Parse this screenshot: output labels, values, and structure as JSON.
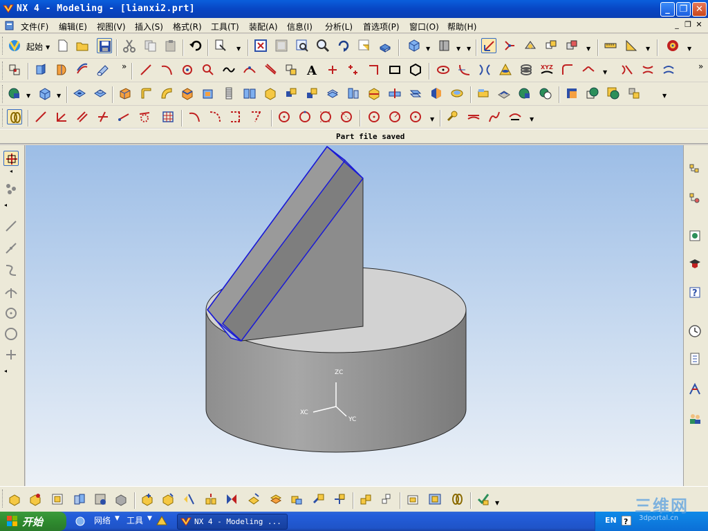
{
  "window": {
    "title": "NX 4 - Modeling - [lianxi2.prt]",
    "minimize_label": "_",
    "restore_label": "❐",
    "close_label": "✕"
  },
  "menu": {
    "items": [
      {
        "label": "文件(F)"
      },
      {
        "label": "编辑(E)"
      },
      {
        "label": "视图(V)"
      },
      {
        "label": "插入(S)"
      },
      {
        "label": "格式(R)"
      },
      {
        "label": "工具(T)"
      },
      {
        "label": "装配(A)"
      },
      {
        "label": "信息(I)"
      },
      {
        "label": "分析(L)"
      },
      {
        "label": "首选项(P)"
      },
      {
        "label": "窗口(O)"
      },
      {
        "label": "帮助(H)"
      }
    ],
    "doc_min": "_",
    "doc_restore": "❐",
    "doc_close": "✕"
  },
  "toolbar": {
    "start_label": "起始"
  },
  "status": {
    "message": "Part file saved"
  },
  "viewport": {
    "axis_z": "ZC",
    "axis_x": "XC",
    "axis_y": "YC"
  },
  "taskbar": {
    "start_label": "开始",
    "network_label": "网络",
    "tools_label": "工具",
    "task_label": "NX 4 - Modeling ...",
    "lang": "EN"
  },
  "watermark": {
    "text": "三维网",
    "url": "3dportal.cn"
  },
  "colors": {
    "title_blue": "#0a5fdc",
    "toolbar_bg": "#ece9d8",
    "model_gray": "#9a9a9a",
    "edge_blue": "#1a1ad6",
    "viewport_top": "#9cbde6"
  }
}
